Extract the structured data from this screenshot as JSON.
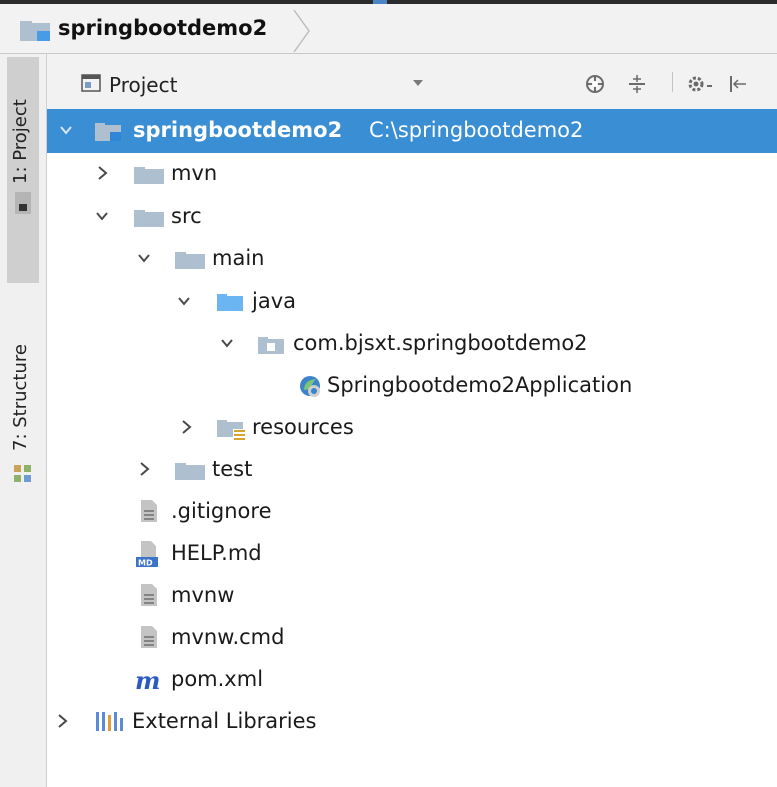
{
  "navbar": {
    "title": "springbootdemo2"
  },
  "strip": {
    "project_tab": "1: Project",
    "structure_tab": "7: Structure"
  },
  "project_panel": {
    "title": "Project"
  },
  "tree": {
    "root": {
      "label": "springbootdemo2",
      "path": "C:\\springbootdemo2"
    },
    "mvn": "mvn",
    "src": "src",
    "main": "main",
    "java": "java",
    "package": "com.bjsxt.springbootdemo2",
    "app_class": "Springbootdemo2Application",
    "resources": "resources",
    "test": "test",
    "gitignore": ".gitignore",
    "help": "HELP.md",
    "mvnw": "mvnw",
    "mvnw_cmd": "mvnw.cmd",
    "pom": "pom.xml",
    "external_libraries": "External Libraries"
  },
  "icons": {
    "folder": "folder-icon",
    "source_folder": "source-folder-icon",
    "package": "package-icon",
    "spring_class": "spring-boot-class-icon",
    "resources_folder": "resources-folder-icon",
    "text_file": "text-file-icon",
    "markdown_file": "markdown-file-icon",
    "maven_file": "maven-icon",
    "libraries": "libraries-icon"
  },
  "colors": {
    "selection": "#3a8ed4",
    "folder": "#aebfcf",
    "source_folder": "#6bb5f2",
    "maven": "#2a5bc4"
  }
}
